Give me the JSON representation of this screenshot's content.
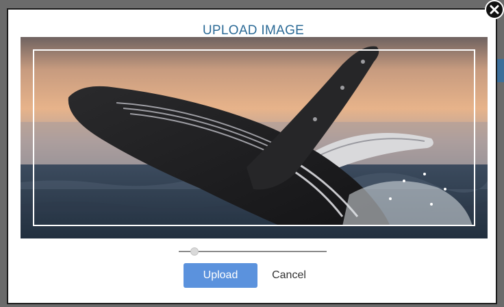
{
  "dialog": {
    "title": "UPLOAD IMAGE",
    "close_icon": "close-icon",
    "zoom_slider": {
      "value": 0.08
    },
    "buttons": {
      "upload_label": "Upload",
      "cancel_label": "Cancel"
    },
    "colors": {
      "title": "#2b6a96",
      "primary_button": "#5b92dd"
    }
  }
}
